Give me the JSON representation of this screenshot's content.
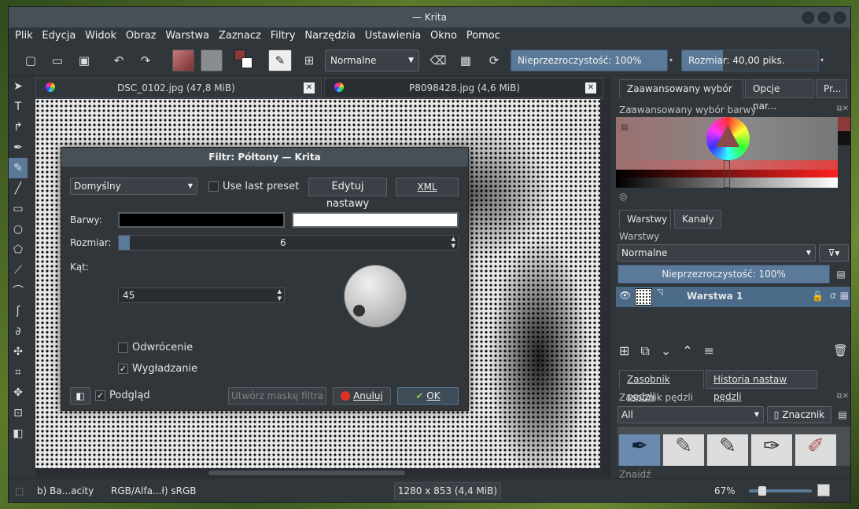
{
  "window": {
    "title": "— Krita"
  },
  "menu": [
    "Plik",
    "Edycja",
    "Widok",
    "Obraz",
    "Warstwa",
    "Zaznacz",
    "Filtry",
    "Narzędzia",
    "Ustawienia",
    "Okno",
    "Pomoc"
  ],
  "toolbar": {
    "blend_mode": "Normalne",
    "opacity_label": "Nieprzezroczystość:  100%",
    "size_label": "Rozmiar:  40,00 piks.",
    "fg_color": "#8b3a3a",
    "bg_color": "#ffffff"
  },
  "tabs": [
    {
      "label": "DSC_0102.jpg (47,8 MiB)"
    },
    {
      "label": "P8098428.jpg (4,6 MiB)"
    }
  ],
  "dialog": {
    "title": "Filtr: Półtony — Krita",
    "preset": "Domyślny",
    "use_last_preset": "Use last preset",
    "edit_presets": "Edytuj nastawy",
    "xml": "XML",
    "colors_label": "Barwy:",
    "color1": "#000000",
    "color2": "#ffffff",
    "size_label": "Rozmiar:",
    "size_value": "6",
    "angle_label": "Kąt:",
    "angle_value": "45",
    "invert_label": "Odwrócenie",
    "antialias_label": "Wygładzanie",
    "antialias_checked": true,
    "preview_label": "Podgląd",
    "create_mask": "Utwórz maskę filtra",
    "cancel": "Anuluj",
    "ok": "OK"
  },
  "status": {
    "layer": "b) Ba...acity",
    "colorspace": "RGB/Alfa...ł)  sRGB",
    "dims": "1280 x 853 (4,4 MiB)",
    "zoom": "67%"
  },
  "dock": {
    "color_tabs": [
      "Zaawansowany wybór ...",
      "Opcje nar...",
      "Pr..."
    ],
    "color_title": "Zaawansowany wybór barwy",
    "layer_tabs": [
      "Warstwy",
      "Kanały"
    ],
    "layers_title": "Warstwy",
    "layer_blend": "Normalne",
    "layer_opacity": "Nieprzezroczystość:  100%",
    "layer_name": "Warstwa 1",
    "brush_tabs": [
      "Zasobnik pędzli",
      "Historia nastaw pędzli"
    ],
    "brush_title": "Zasobnik pędzli",
    "brush_filter": "All",
    "brush_tag": "Znacznik",
    "search_placeholder": "Znajdź"
  }
}
